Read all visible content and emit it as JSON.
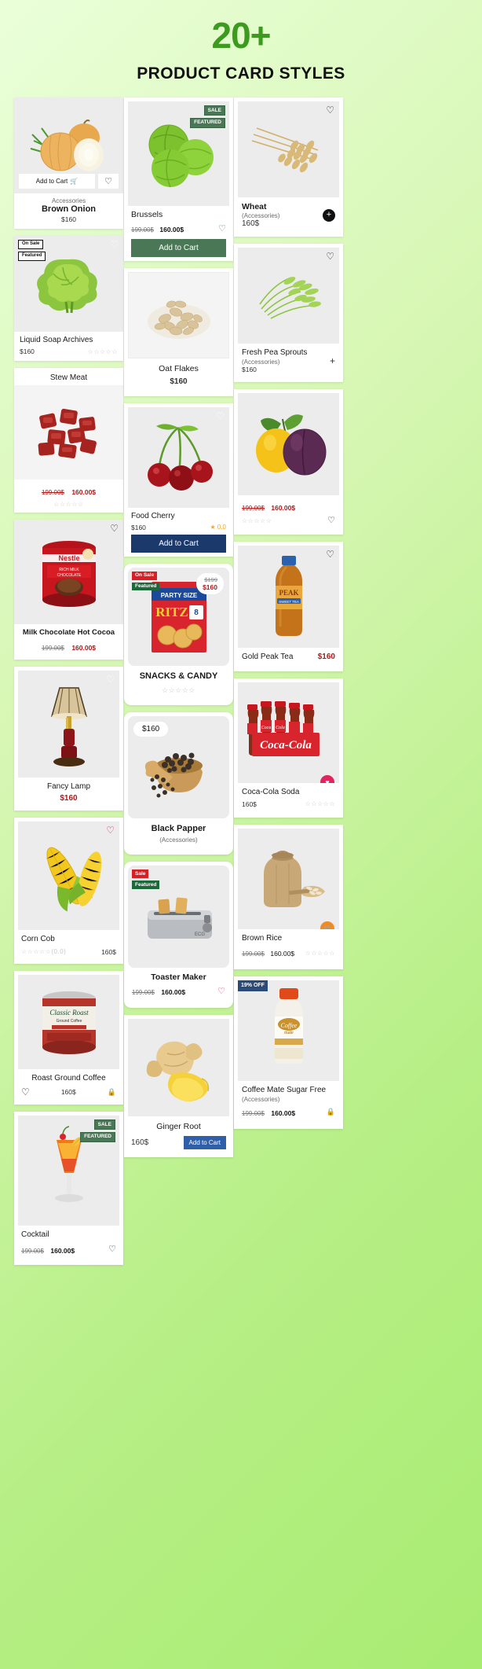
{
  "header": {
    "big": "20+",
    "sub": "PRODUCT CARD STYLES",
    "accent": "#3c9a1e"
  },
  "labels": {
    "add_to_cart": "Add to Cart",
    "sale": "SALE",
    "featured_caps": "FEATURED",
    "on_sale": "On Sale",
    "featured": "Featured",
    "sale_cap": "Sale",
    "plus": "+",
    "stars_empty": "☆☆☆☆☆",
    "cart_icon": "🛒",
    "heart_icon": "♡",
    "heart_filled": "♥",
    "lock_icon": "🔒"
  },
  "cards": {
    "brown_onion": {
      "title": "Brown Onion",
      "category": "Accessories",
      "price": "$160",
      "cta": "Add to Cart"
    },
    "brussels": {
      "title": "Brussels",
      "old": "199.00$",
      "new": "160.00$",
      "cta": "Add to Cart",
      "badge1": "SALE",
      "badge2": "FEATURED"
    },
    "wheat": {
      "title": "Wheat",
      "category": "(Accessories)",
      "price": "160$",
      "plus": "+"
    },
    "liquid_soap": {
      "title": "Liquid Soap Archives",
      "price": "$160",
      "badge1": "On Sale",
      "badge2": "Featured",
      "stars": "☆☆☆☆☆"
    },
    "oat_flakes": {
      "title": "Oat Flakes",
      "price": "$160"
    },
    "pea_sprouts": {
      "title": "Fresh Pea Sprouts",
      "category": "(Accessories)",
      "price": "$160",
      "plus": "+"
    },
    "stew_meat": {
      "title": "Stew Meat",
      "old": "199.00$",
      "new": "160.00$",
      "stars": "☆☆☆☆☆"
    },
    "food_cherry": {
      "title": "Food Cherry",
      "price": "$160",
      "rating": "0.0",
      "cta": "Add to Cart"
    },
    "plum": {
      "old": "199.00$",
      "new": "160.00$",
      "stars": "☆☆☆☆☆"
    },
    "hot_cocoa": {
      "title": "Milk Chocolate Hot Cocoa",
      "old": "199.00$",
      "new": "160.00$"
    },
    "snacks": {
      "title": "SNACKS & CANDY",
      "old": "$199",
      "new": "$160",
      "badge1": "On Sale",
      "badge2": "Featured",
      "stars": "☆☆☆☆☆"
    },
    "gold_peak": {
      "title": "Gold Peak Tea",
      "price": "$160"
    },
    "fancy_lamp": {
      "title": "Fancy Lamp",
      "price": "$160"
    },
    "black_papper": {
      "title": "Black Papper",
      "category": "(Accessories)",
      "price": "$160"
    },
    "coca_cola": {
      "title": "Coca-Cola Soda",
      "price": "160$",
      "stars": "☆☆☆☆☆"
    },
    "corn_cob": {
      "title": "Corn Cob",
      "price": "160$",
      "stars": "☆☆☆☆☆(0.0)"
    },
    "toaster": {
      "title": "Toaster Maker",
      "old": "199.00$",
      "new": "160.00$",
      "badge1": "Sale",
      "badge2": "Featured"
    },
    "brown_rice": {
      "title": "Brown Rice",
      "old": "199.00$",
      "new": "160.00$",
      "stars": "☆☆☆☆☆"
    },
    "roast_coffee": {
      "title": "Roast Ground Coffee",
      "price": "160$"
    },
    "ginger_root": {
      "title": "Ginger Root",
      "price": "160$",
      "cta": "Add to Cart"
    },
    "coffee_mate": {
      "title": "Coffee Mate Sugar Free",
      "category": "(Accessories)",
      "old": "199.00$",
      "new": "160.00$",
      "badge": "19% OFF"
    },
    "cocktail": {
      "title": "Cocktail",
      "old": "199.00$",
      "new": "160.00$",
      "badge1": "SALE",
      "badge2": "FEATURED"
    }
  }
}
